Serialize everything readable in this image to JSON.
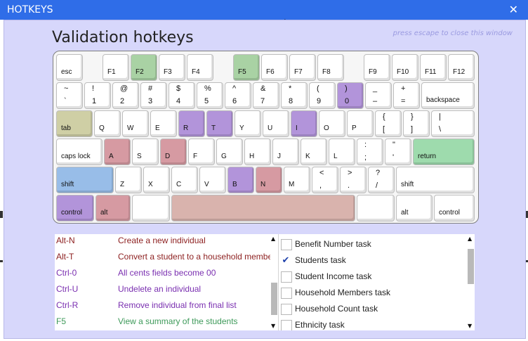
{
  "window": {
    "title": "HOTKEYS",
    "close_glyph": "✕"
  },
  "heading": "Validation hotkeys",
  "escape_note": "press escape to close this window",
  "colors": {
    "green": "#a9d2a4",
    "lavender": "#b294da",
    "rose": "#d69aa2",
    "khaki": "#cfcfa5",
    "blue": "#98bde8",
    "mint": "#9edbad",
    "space": "#d9b3ad"
  },
  "keyboard": {
    "rows": [
      [
        {
          "id": "esc",
          "label": "esc"
        },
        {
          "id": "f1",
          "label": "F1"
        },
        {
          "id": "f2",
          "label": "F2",
          "color": "#a9d2a4"
        },
        {
          "id": "f3",
          "label": "F3"
        },
        {
          "id": "f4",
          "label": "F4"
        },
        {
          "id": "f5",
          "label": "F5",
          "color": "#a9d2a4"
        },
        {
          "id": "f6",
          "label": "F6"
        },
        {
          "id": "f7",
          "label": "F7"
        },
        {
          "id": "f8",
          "label": "F8"
        },
        {
          "id": "f9",
          "label": "F9"
        },
        {
          "id": "f10",
          "label": "F10"
        },
        {
          "id": "f11",
          "label": "F11"
        },
        {
          "id": "f12",
          "label": "F12"
        }
      ],
      [
        {
          "id": "backquote",
          "top": "~",
          "bottom": "`"
        },
        {
          "id": "1",
          "top": "!",
          "bottom": "1"
        },
        {
          "id": "2",
          "top": "@",
          "bottom": "2"
        },
        {
          "id": "3",
          "top": "#",
          "bottom": "3"
        },
        {
          "id": "4",
          "top": "$",
          "bottom": "4"
        },
        {
          "id": "5",
          "top": "%",
          "bottom": "5"
        },
        {
          "id": "6",
          "top": "^",
          "bottom": "6"
        },
        {
          "id": "7",
          "top": "&",
          "bottom": "7"
        },
        {
          "id": "8",
          "top": "*",
          "bottom": "8"
        },
        {
          "id": "9",
          "top": "(",
          "bottom": "9"
        },
        {
          "id": "0",
          "top": ")",
          "bottom": "0",
          "color": "#b294da"
        },
        {
          "id": "minus",
          "top": "_",
          "bottom": "–"
        },
        {
          "id": "equals",
          "top": "+",
          "bottom": "="
        },
        {
          "id": "backspace",
          "label": "backspace"
        }
      ],
      [
        {
          "id": "tab",
          "label": "tab",
          "color": "#cfcfa5"
        },
        {
          "id": "q",
          "label": "Q"
        },
        {
          "id": "w",
          "label": "W"
        },
        {
          "id": "e",
          "label": "E"
        },
        {
          "id": "r",
          "label": "R",
          "color": "#b294da"
        },
        {
          "id": "t",
          "label": "T",
          "color": "#b294da"
        },
        {
          "id": "y",
          "label": "Y"
        },
        {
          "id": "u",
          "label": "U"
        },
        {
          "id": "i",
          "label": "I",
          "color": "#b294da"
        },
        {
          "id": "o",
          "label": "O"
        },
        {
          "id": "p",
          "label": "P"
        },
        {
          "id": "lbracket",
          "top": "{",
          "bottom": "["
        },
        {
          "id": "rbracket",
          "top": "}",
          "bottom": "]"
        },
        {
          "id": "backslash",
          "top": "|",
          "bottom": "\\"
        }
      ],
      [
        {
          "id": "capslock",
          "label": "caps lock"
        },
        {
          "id": "a",
          "label": "A",
          "color": "#d69aa2"
        },
        {
          "id": "s",
          "label": "S"
        },
        {
          "id": "d",
          "label": "D",
          "color": "#d69aa2"
        },
        {
          "id": "f",
          "label": "F"
        },
        {
          "id": "g",
          "label": "G"
        },
        {
          "id": "h",
          "label": "H"
        },
        {
          "id": "j",
          "label": "J"
        },
        {
          "id": "k",
          "label": "K"
        },
        {
          "id": "l",
          "label": "L"
        },
        {
          "id": "semicolon",
          "top": ":",
          "bottom": ";"
        },
        {
          "id": "quote",
          "top": "\"",
          "bottom": "'"
        },
        {
          "id": "return",
          "label": "return",
          "color": "#9edbad"
        }
      ],
      [
        {
          "id": "shift-left",
          "label": "shift",
          "color": "#98bde8"
        },
        {
          "id": "z",
          "label": "Z"
        },
        {
          "id": "x",
          "label": "X"
        },
        {
          "id": "c",
          "label": "C"
        },
        {
          "id": "v",
          "label": "V"
        },
        {
          "id": "b",
          "label": "B",
          "color": "#b294da"
        },
        {
          "id": "n",
          "label": "N",
          "color": "#d69aa2"
        },
        {
          "id": "m",
          "label": "M"
        },
        {
          "id": "comma",
          "top": "<",
          "bottom": ","
        },
        {
          "id": "period",
          "top": ">",
          "bottom": "."
        },
        {
          "id": "slash",
          "top": "?",
          "bottom": "/"
        },
        {
          "id": "shift-right",
          "label": "shift"
        }
      ],
      [
        {
          "id": "control-left",
          "label": "control",
          "color": "#b294da"
        },
        {
          "id": "alt-left",
          "label": "alt",
          "color": "#d69aa2"
        },
        {
          "id": "blank-left",
          "label": ""
        },
        {
          "id": "space",
          "label": "",
          "color": "#d9b3ad"
        },
        {
          "id": "blank-right",
          "label": ""
        },
        {
          "id": "alt-right",
          "label": "alt"
        },
        {
          "id": "control-right",
          "label": "control"
        }
      ]
    ]
  },
  "hotkeys": [
    {
      "key": "Alt-N",
      "desc": "Create a new individual",
      "color": "#8e2222"
    },
    {
      "key": "Alt-T",
      "desc": "Convert a student to a household member",
      "color": "#8e2222"
    },
    {
      "key": "Ctrl-0",
      "desc": "All cents fields become 00",
      "color": "#7a2fb0"
    },
    {
      "key": "Ctrl-U",
      "desc": "Undelete an individual",
      "color": "#7a2fb0"
    },
    {
      "key": "Ctrl-R",
      "desc": "Remove individual from final list",
      "color": "#7a2fb0"
    },
    {
      "key": "F5",
      "desc": "View a summary of the students",
      "color": "#3e9a5a"
    }
  ],
  "tasks": [
    {
      "label": "Benefit Number task",
      "checked": false
    },
    {
      "label": "Students task",
      "checked": true
    },
    {
      "label": "Student Income task",
      "checked": false
    },
    {
      "label": "Household Members task",
      "checked": false
    },
    {
      "label": "Household Count task",
      "checked": false
    },
    {
      "label": "Ethnicity task",
      "checked": false
    }
  ],
  "scroll": {
    "hotkeys_position": 0.85,
    "tasks_position": 0.15,
    "check_glyph": "✔",
    "up_glyph": "▲",
    "down_glyph": "▼"
  }
}
